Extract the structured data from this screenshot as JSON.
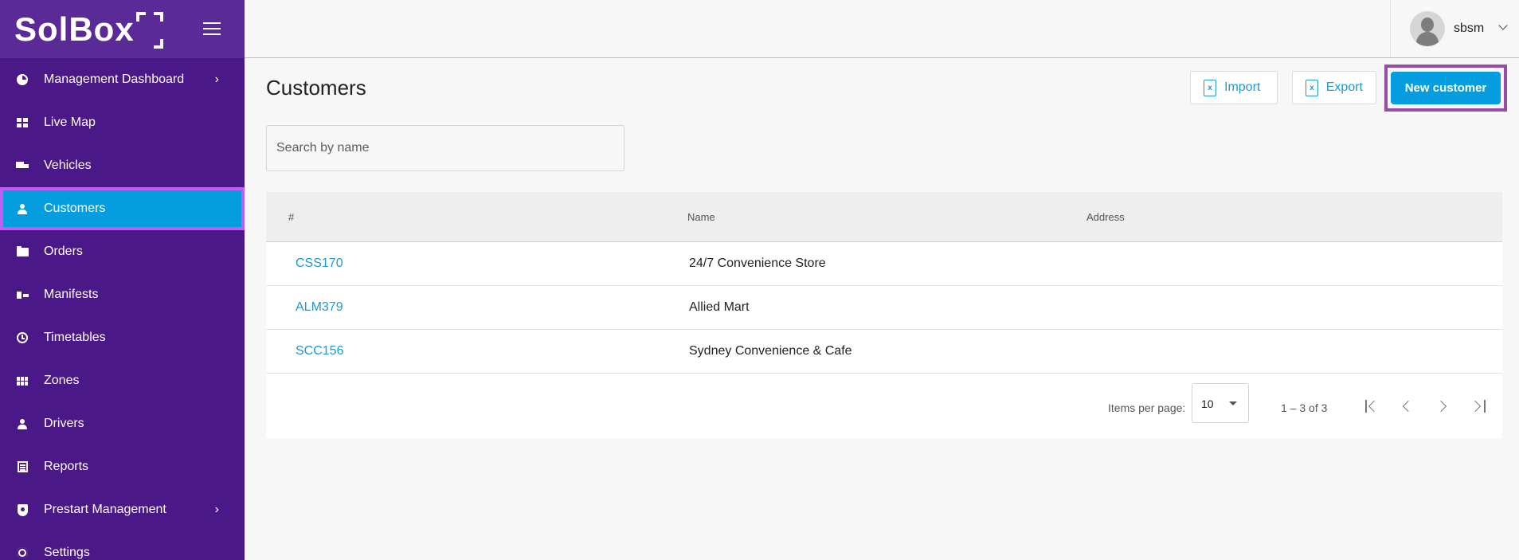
{
  "brand": {
    "name": "SolBox"
  },
  "colors": {
    "sidebar": "#4b1887",
    "accent": "#049ee0",
    "link": "#1c98d6",
    "highlight": "#c35cf5"
  },
  "sidebar": {
    "items": [
      {
        "label": "Management Dashboard",
        "icon": "pie-chart-icon",
        "expandable": true
      },
      {
        "label": "Live Map",
        "icon": "dashboard-icon"
      },
      {
        "label": "Vehicles",
        "icon": "truck-icon"
      },
      {
        "label": "Customers",
        "icon": "person-icon",
        "active": true
      },
      {
        "label": "Orders",
        "icon": "folder-icon"
      },
      {
        "label": "Manifests",
        "icon": "manifest-icon"
      },
      {
        "label": "Timetables",
        "icon": "clock-icon"
      },
      {
        "label": "Zones",
        "icon": "zones-icon"
      },
      {
        "label": "Drivers",
        "icon": "person-icon"
      },
      {
        "label": "Reports",
        "icon": "report-icon"
      },
      {
        "label": "Prestart Management",
        "icon": "shield-icon",
        "expandable": true
      },
      {
        "label": "Settings",
        "icon": "gear-icon"
      }
    ]
  },
  "header": {
    "user_name": "sbsm"
  },
  "page": {
    "title": "Customers",
    "import_label": "Import",
    "export_label": "Export",
    "new_label": "New customer",
    "search_placeholder": "Search by name"
  },
  "table": {
    "columns": [
      "#",
      "Name",
      "Address"
    ],
    "rows": [
      {
        "id": "CSS170",
        "name": "24/7 Convenience Store",
        "address": ""
      },
      {
        "id": "ALM379",
        "name": "Allied Mart",
        "address": ""
      },
      {
        "id": "SCC156",
        "name": "Sydney Convenience & Cafe",
        "address": ""
      }
    ]
  },
  "pagination": {
    "items_per_page_label": "Items per page:",
    "items_per_page": "10",
    "range": "1 – 3 of 3"
  }
}
